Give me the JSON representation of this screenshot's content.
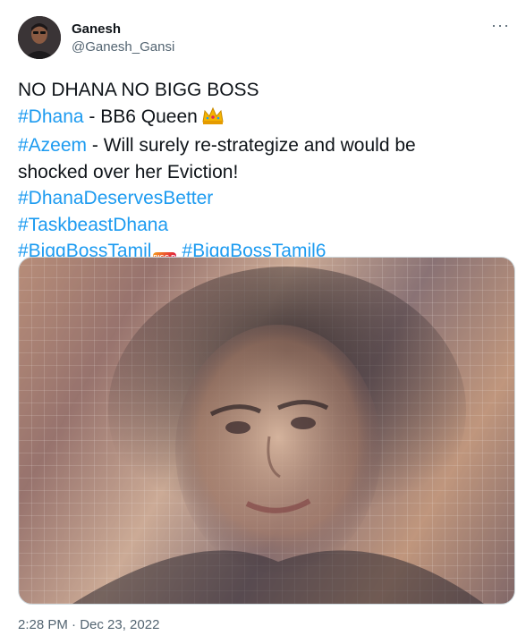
{
  "author": {
    "name": "Ganesh",
    "handle": "@Ganesh_Gansi"
  },
  "menu_icon": "more-horizontal-icon",
  "tweet": {
    "line1": "NO DHANA NO BIGG BOSS",
    "line2_tag": "#Dhana",
    "line2_text": " - BB6 Queen",
    "line3_tag": "#Azeem",
    "line3_text": " - Will surely re-strategize and would be",
    "line4_text": "shocked over her Eviction!",
    "line5_tag": "#DhanaDeservesBetter",
    "line6_tag": "#TaskbeastDhana",
    "line7_tag1": "#BiggBossTamil",
    "line7_tag2": "#BiggBossTamil6",
    "badge_text": "BIGG BOSS"
  },
  "timestamp": "2:28 PM · Dec 23, 2022",
  "colors": {
    "text": "#0f1419",
    "secondary": "#536471",
    "link": "#1d9bf0"
  }
}
